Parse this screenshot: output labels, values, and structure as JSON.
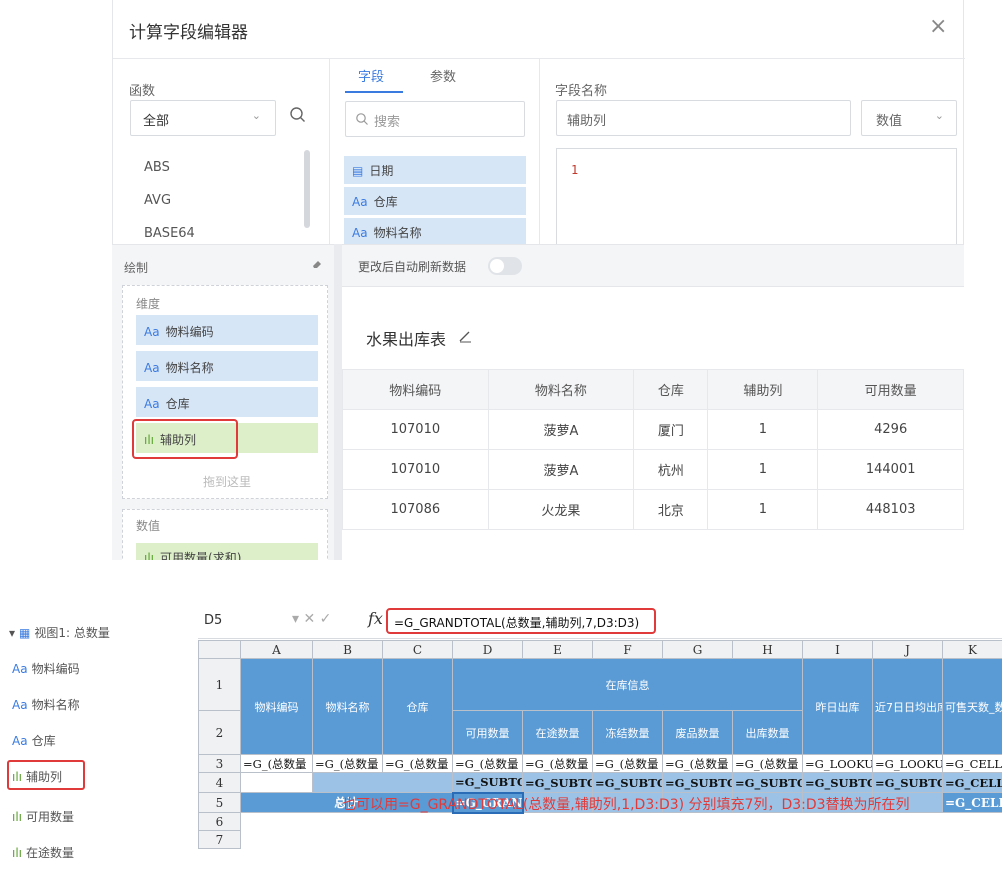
{
  "dialog": {
    "title": "计算字段编辑器",
    "close_glyph": "×",
    "functions": {
      "label": "函数",
      "category": "全部",
      "items": [
        "ABS",
        "AVG",
        "BASE64"
      ]
    },
    "tabs": [
      "字段",
      "参数"
    ],
    "field_search_placeholder": "搜索",
    "fields": [
      {
        "type": "日期",
        "type_glyph": "▤",
        "name": "日期"
      },
      {
        "type": "文本",
        "type_glyph": "Aa",
        "name": "仓库"
      },
      {
        "type": "文本",
        "type_glyph": "Aa",
        "name": "物料名称"
      }
    ],
    "field_name_label": "字段名称",
    "field_name_value": "辅助列",
    "field_type": "数值",
    "editor_line": "1"
  },
  "draw": {
    "label": "绘制",
    "dimension_label": "维度",
    "dimensions": [
      "物料编码",
      "物料名称",
      "仓库",
      "辅助列"
    ],
    "dim_type_glyph": "Aa",
    "measure_glyph": "ılı",
    "drop_hint": "拖到这里",
    "value_label": "数值",
    "values": [
      "可用数量(求和)"
    ]
  },
  "preview": {
    "auto_refresh_label": "更改后自动刷新数据",
    "table_title": "水果出库表",
    "columns": [
      "物料编码",
      "物料名称",
      "仓库",
      "辅助列",
      "可用数量"
    ],
    "rows": [
      [
        "107010",
        "菠萝A",
        "厦门",
        "1",
        "4296"
      ],
      [
        "107010",
        "菠萝A",
        "杭州",
        "1",
        "144001"
      ],
      [
        "107086",
        "火龙果",
        "北京",
        "1",
        "448103"
      ]
    ]
  },
  "tree": {
    "root": "视图1: 总数量",
    "items": [
      {
        "glyph": "Aa",
        "label": "物料编码"
      },
      {
        "glyph": "Aa",
        "label": "物料名称"
      },
      {
        "glyph": "Aa",
        "label": "仓库"
      },
      {
        "glyph": "ılı",
        "label": "辅助列"
      },
      {
        "glyph": "ılı",
        "label": "可用数量"
      },
      {
        "glyph": "ılı",
        "label": "在途数量"
      }
    ]
  },
  "sheet": {
    "cell_ref": "D5",
    "formula": "=G_GRANDTOTAL(总数量,辅助列,7,D3:D3)",
    "col_headers": [
      "A",
      "B",
      "C",
      "D",
      "E",
      "F",
      "G",
      "H",
      "I",
      "J",
      "K"
    ],
    "row_numbers": [
      "1",
      "2",
      "3",
      "4",
      "5",
      "6",
      "7"
    ],
    "header_row1": {
      "a": "物料编码",
      "b": "物料名称",
      "c": "仓库",
      "group": "在库信息",
      "i": "昨日出库",
      "j": "近7日日均出库",
      "k": "可售天数_数"
    },
    "header_row2": [
      "可用数量",
      "在途数量",
      "冻结数量",
      "废品数量",
      "出库数量"
    ],
    "row3": [
      "=G_(总数量",
      "=G_(总数量",
      "=G_(总数量",
      "=G_(总数量",
      "=G_(总数量",
      "=G_(总数量",
      "=G_(总数量",
      "=G_(总数量",
      "=G_LOOKU",
      "=G_LOOKU",
      "=G_CELL"
    ],
    "row4": [
      "=G_SUBTO",
      "=G_SUBTO",
      "=G_SUBTO",
      "=G_SUBTO",
      "=G_SUBTO",
      "=G_SUBTO",
      "=G_SUBTO",
      "=G_CELL"
    ],
    "total_label": "总计",
    "d5": "=G_GRANI",
    "k5": "=G_CELL",
    "note": "也可以用=G_GRANDTOTAL(总数量,辅助列,1,D3:D3) 分别填充7列，D3:D3替换为所在列"
  }
}
